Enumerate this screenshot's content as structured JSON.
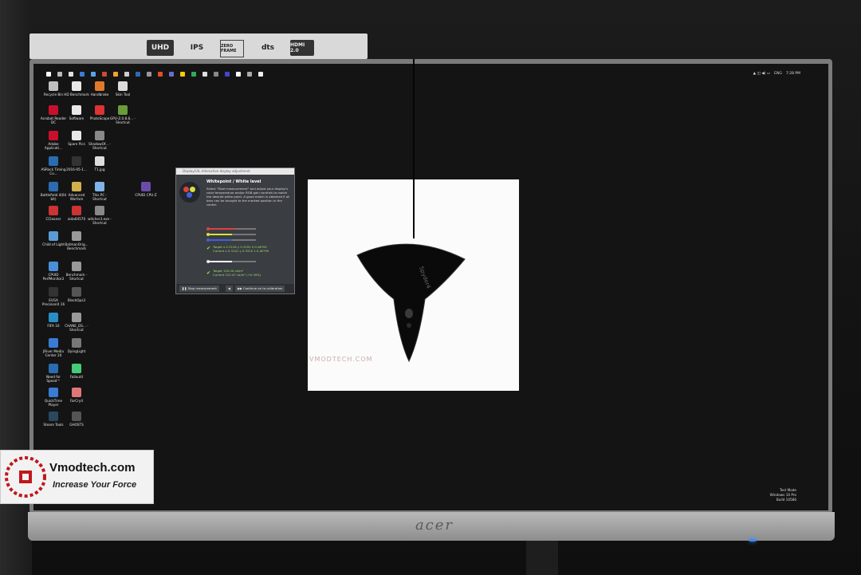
{
  "monitor": {
    "brand": "acer",
    "stickers": [
      "UHD",
      "IPS",
      "ZERO FRAME",
      "dts",
      "HDMI 2.0"
    ]
  },
  "taskbar": {
    "language": "ENG",
    "time": "7:28 PM",
    "icon_colors": [
      "#ffffff",
      "#bbbbbb",
      "#e0e0e0",
      "#3a7bd5",
      "#57a5e8",
      "#d14836",
      "#f0a030",
      "#cccccc",
      "#2b6cb0",
      "#999999",
      "#e34c26",
      "#6b6bd1",
      "#ffcc00",
      "#33aa55",
      "#dddddd",
      "#888888",
      "#44c",
      "#ffffff",
      "#aaa",
      "#eee"
    ]
  },
  "desktop": {
    "icons": [
      {
        "label": "Recycle Bin",
        "color": "#bfbfbf"
      },
      {
        "label": "HD Benchmark",
        "color": "#e8e8e8"
      },
      {
        "label": "Handbrake",
        "color": "#e07a2b"
      },
      {
        "label": "Skin Tool",
        "color": "#dcdcdc"
      },
      {
        "label": "Acrobat Reader DC",
        "color": "#c8102e"
      },
      {
        "label": "Software",
        "color": "#e8e8e8"
      },
      {
        "label": "PhotoScape",
        "color": "#d33"
      },
      {
        "label": "GPU-Z.0.8.8... - Shortcut",
        "color": "#6a9c3a"
      },
      {
        "label": "Adobe Applicati...",
        "color": "#c8102e"
      },
      {
        "label": "Spare Pics",
        "color": "#e8e8e8"
      },
      {
        "label": "ShadowOf... - Shortcut",
        "color": "#888"
      },
      {
        "label": "ASRock Timing Co...",
        "color": "#2b6cb0"
      },
      {
        "label": "2016-05-1...",
        "color": "#333"
      },
      {
        "label": "T1.jpg",
        "color": "#ddd"
      },
      {
        "label": "Battlefield 4(64 bit)",
        "color": "#2b6cb0"
      },
      {
        "label": "Advanced Warfare",
        "color": "#d2b04c"
      },
      {
        "label": "This PC - Shortcut",
        "color": "#7fb3e8"
      },
      {
        "label": "CPUID CPU-Z",
        "color": "#6a4ca8"
      },
      {
        "label": "CCleaner",
        "color": "#c33"
      },
      {
        "label": "aida64570",
        "color": "#c33"
      },
      {
        "label": "witcher3.exe - Shortcut",
        "color": "#888"
      },
      {
        "label": "Child of Light",
        "color": "#5b9bd5"
      },
      {
        "label": "BatmanOrig... Benchmark",
        "color": "#999"
      },
      {
        "label": "Benchmark - Shortcut",
        "color": "#999"
      },
      {
        "label": "CPUID PerfMonitor2",
        "color": "#4a90d9"
      },
      {
        "label": "BlackOps3",
        "color": "#555"
      },
      {
        "label": "EVGA PrecisionX 16",
        "color": "#333"
      },
      {
        "label": "CHANE_DS... - Shortcut",
        "color": "#999"
      },
      {
        "label": "FIFA 16",
        "color": "#2a8ec6"
      },
      {
        "label": "DyingLight",
        "color": "#777"
      },
      {
        "label": "JRiver Media Center 20",
        "color": "#3a7bd5"
      },
      {
        "label": "Fallout4",
        "color": "#4c7"
      },
      {
        "label": "Need for Speed™",
        "color": "#2b6cb0"
      },
      {
        "label": "FarCry4",
        "color": "#d77"
      },
      {
        "label": "QuickTime Player",
        "color": "#3a7bd5"
      },
      {
        "label": "GHOSTS",
        "color": "#555"
      },
      {
        "label": "Steam Tools",
        "color": "#2a475e"
      }
    ]
  },
  "dialog": {
    "titlebar": "DisplayCAL Interactive display adjustment",
    "heading": "Whitepoint / White level",
    "body": "Select \"Start measurement\" and adjust your display's color temperature and/or RGB gain controls to match the desired white point. A good match is obtained if all bars can be brought to the marked position in the center.",
    "target_xy": "Target x 0.3128 y 0.3292 0.0 ΔE*00",
    "current_xy": "Current x 0.3141 y 0.3310 1.0 ΔE*00",
    "target_lum": "Target 120.00 cd/m²",
    "current_lum": "Current 120.47 cd/m² (+0.39%)",
    "stop_button": "Stop measurement",
    "continue_button": "Continue on to calibration",
    "colors": {
      "red": "#e04040",
      "green": "#d8e040",
      "blue": "#4060e0",
      "check": "#88ff22"
    }
  },
  "build_info": [
    "Test Mode",
    "Windows 10 Pro",
    "Build 10586"
  ],
  "watermark": {
    "title": "Vmodtech.com",
    "tagline": "Increase Your Force",
    "center_mark": "VMODTECH.COM"
  },
  "colorimeter": {
    "label": "Spyder4"
  }
}
